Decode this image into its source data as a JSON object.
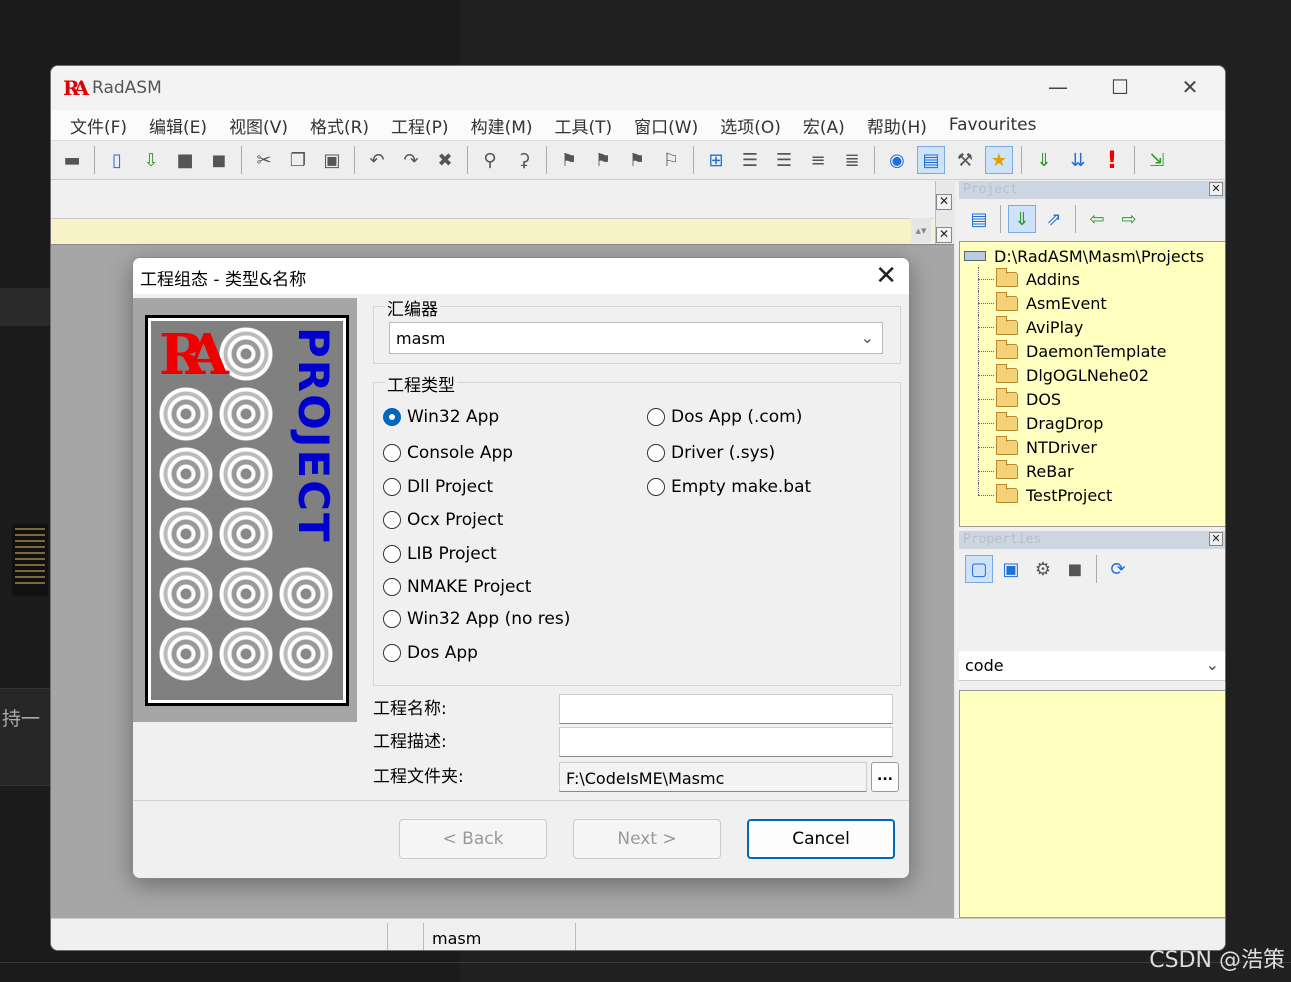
{
  "window": {
    "title": "RadASM",
    "logo": "RA"
  },
  "menu": [
    "文件(F)",
    "编辑(E)",
    "视图(V)",
    "格式(R)",
    "工程(P)",
    "构建(M)",
    "工具(T)",
    "窗口(W)",
    "选项(O)",
    "宏(A)",
    "帮助(H)",
    "Favourites"
  ],
  "toolbar_icons": [
    "print-icon",
    "new-file-icon",
    "open-file-icon",
    "save-icon",
    "save-all-icon",
    "cut-icon",
    "copy-icon",
    "paste-icon",
    "undo-icon",
    "redo-icon",
    "delete-icon",
    "find-icon",
    "replace-icon",
    "bookmark-icon",
    "next-bookmark-icon",
    "prev-bookmark-icon",
    "clear-bookmarks-icon",
    "block-icon",
    "indent-icon",
    "outdent-icon",
    "comment-icon",
    "uncomment-icon",
    "output-icon",
    "project-icon",
    "tools-icon",
    "properties-icon",
    "assemble-icon",
    "build-icon",
    "run-icon",
    "export-icon"
  ],
  "project_panel": {
    "header": "Project",
    "root": "D:\\RadASM\\Masm\\Projects",
    "folders": [
      "Addins",
      "AsmEvent",
      "AviPlay",
      "DaemonTemplate",
      "DlgOGLNehe02",
      "DOS",
      "DragDrop",
      "NTDriver",
      "ReBar",
      "TestProject"
    ]
  },
  "properties_panel": {
    "header": "Properties",
    "selected": "code"
  },
  "statusbar": {
    "assembler": "masm"
  },
  "dialog": {
    "title": "工程组态 - 类型&名称",
    "art_word": "PROJECT",
    "art_logo": "RA",
    "assembler_group": "汇编器",
    "assembler_value": "masm",
    "type_group": "工程类型",
    "types_left": [
      "Win32 App",
      "Console App",
      "Dll Project",
      "Ocx Project",
      "LIB Project",
      "NMAKE Project",
      "Win32 App (no res)",
      "Dos App"
    ],
    "types_right": [
      "Dos App (.com)",
      "Driver (.sys)",
      "Empty make.bat"
    ],
    "selected_type": "Win32 App",
    "name_label": "工程名称:",
    "name_value": "",
    "desc_label": "工程描述:",
    "desc_value": "",
    "folder_label": "工程文件夹:",
    "folder_value": "F:\\CodeIsME\\Masmc",
    "browse_label": "...",
    "back_label": "< Back",
    "next_label": "Next >",
    "cancel_label": "Cancel"
  },
  "background": {
    "text_fragment": "持一",
    "watermark": "CSDN @浩策"
  }
}
